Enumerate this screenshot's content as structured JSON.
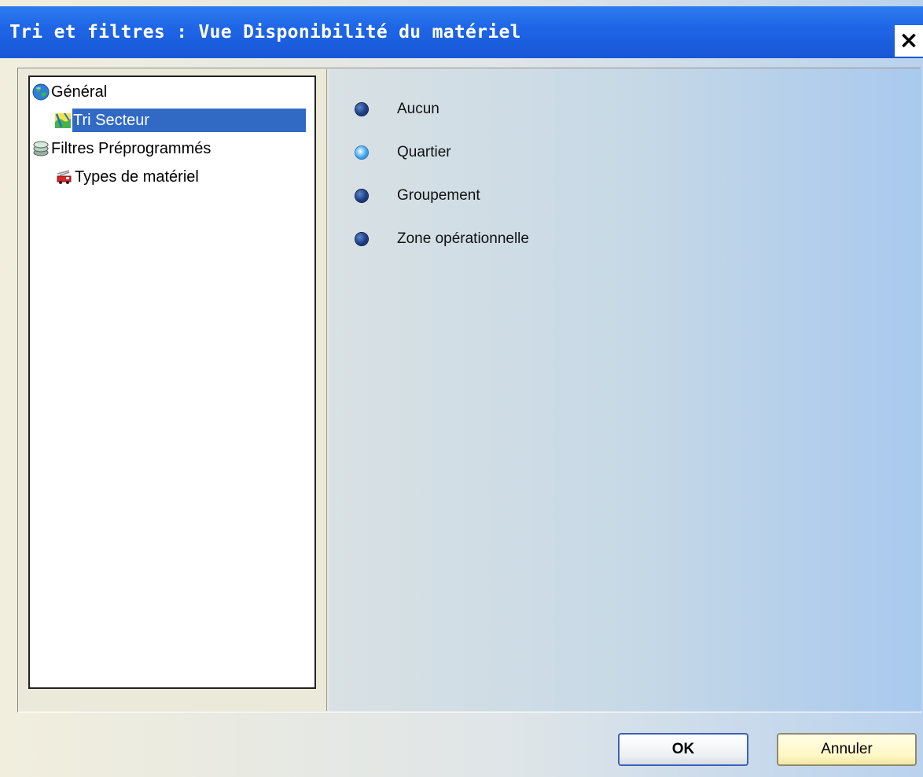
{
  "window": {
    "title": "Tri et filtres : Vue Disponibilité du matériel",
    "close_label": "×"
  },
  "tree": {
    "items": [
      {
        "label": "Général",
        "icon": "globe-icon",
        "level": 0,
        "selected": false
      },
      {
        "label": "Tri Secteur",
        "icon": "map-sector-icon",
        "level": 1,
        "selected": true
      },
      {
        "label": "Filtres Préprogrammés",
        "icon": "stack-icon",
        "level": 0,
        "selected": false
      },
      {
        "label": "Types de matériel",
        "icon": "fire-truck-icon",
        "level": 1,
        "selected": false
      }
    ]
  },
  "options": {
    "selected": "Quartier",
    "items": [
      {
        "label": "Aucun"
      },
      {
        "label": "Quartier"
      },
      {
        "label": "Groupement"
      },
      {
        "label": "Zone opérationnelle"
      }
    ]
  },
  "buttons": {
    "ok_label": "OK",
    "cancel_label": "Annuler"
  },
  "colors": {
    "titlebar": "#1f66e6",
    "selection": "#316ac5",
    "radio_selected": "#3b9ee6",
    "radio_unselected": "#1c3e86"
  }
}
